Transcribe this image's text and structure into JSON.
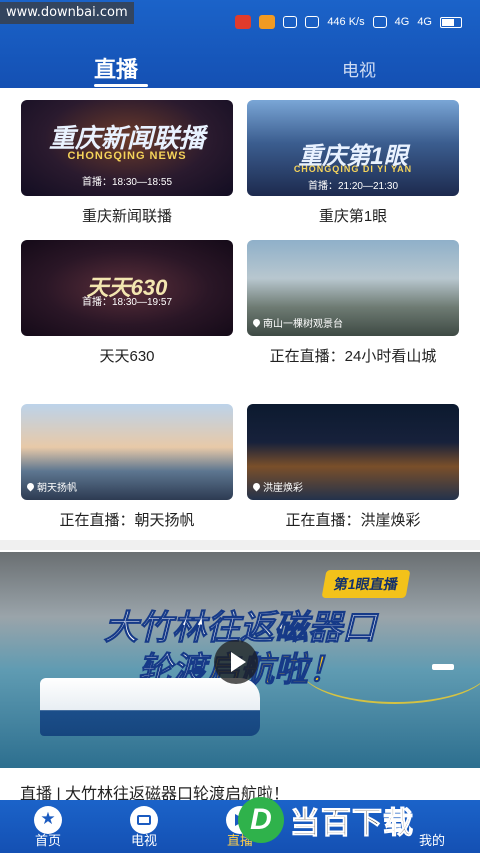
{
  "watermark_top": "www.downbai.com",
  "status_bar": {
    "network_speed": "446 K/s",
    "signal1": "4G",
    "signal2": "4G"
  },
  "tabs": {
    "live": "直播",
    "tv": "电视"
  },
  "channels": [
    {
      "title": "重庆新闻联播",
      "thumb_big": "重庆新闻联播",
      "thumb_sub": "CHONGQING NEWS",
      "caption": "首播：18:30—18:55"
    },
    {
      "title": "重庆第1眼",
      "thumb_big": "重庆第1眼",
      "thumb_sub": "CHONGQING DI YI YAN",
      "caption": "首播：21:20—21:30"
    },
    {
      "title": "天天630",
      "thumb_big": "天天630",
      "caption": "首播：18:30—19:57"
    },
    {
      "title": "正在直播：24小时看山城",
      "location": "南山一棵树观景台"
    },
    {
      "title": "正在直播：朝天扬帆",
      "location": "朝天扬帆"
    },
    {
      "title": "正在直播：洪崖焕彩",
      "location": "洪崖焕彩"
    }
  ],
  "banner": {
    "badge": "第1眼直播",
    "line1": "大竹林往返磁器口",
    "line2_a": "轮渡",
    "line2_b": "启航啦！",
    "title": "直播 | 大竹林往返磁器口轮渡启航啦！"
  },
  "bottom_nav": [
    {
      "label": "首页",
      "icon": "star-icon"
    },
    {
      "label": "电视",
      "icon": "tv-icon"
    },
    {
      "label": "直播",
      "icon": "live-icon"
    },
    {
      "label": "",
      "icon": ""
    },
    {
      "label": "我的",
      "icon": ""
    }
  ],
  "watermark_logo": {
    "letter": "D",
    "text": "当百下载"
  },
  "colors": {
    "primary": "#1b5bc0",
    "accent": "#f8c21b",
    "badge_green": "#2fb24b"
  }
}
